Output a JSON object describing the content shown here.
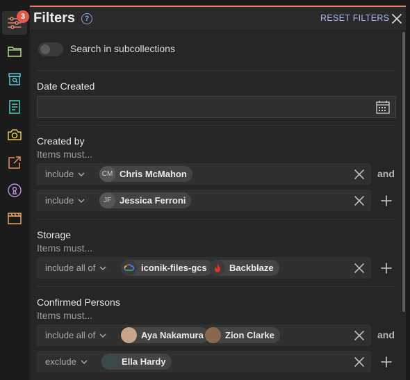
{
  "rail": {
    "badge": "3",
    "items": [
      "filters-icon",
      "folder-icon",
      "collection-search-icon",
      "document-icon",
      "camera-icon",
      "share-icon",
      "keyhole-icon",
      "clapperboard-icon"
    ]
  },
  "header": {
    "title": "Filters",
    "help": "?",
    "reset": "RESET FILTERS"
  },
  "subcollections": {
    "label": "Search in subcollections",
    "enabled": false
  },
  "date_created": {
    "title": "Date Created",
    "value": ""
  },
  "created_by": {
    "title": "Created by",
    "subtitle": "Items must...",
    "rows": [
      {
        "mode": "include",
        "chips": [
          {
            "initials": "CM",
            "name": "Chris McMahon"
          }
        ],
        "conj": "and"
      },
      {
        "mode": "include",
        "chips": [
          {
            "initials": "JF",
            "name": "Jessica Ferroni"
          }
        ]
      }
    ]
  },
  "storage": {
    "title": "Storage",
    "subtitle": "Items must...",
    "rows": [
      {
        "mode": "include all of",
        "chips": [
          {
            "name": "iconik-files-gcs"
          },
          {
            "name": "Backblaze"
          }
        ]
      }
    ]
  },
  "confirmed_persons": {
    "title": "Confirmed Persons",
    "subtitle": "Items must...",
    "rows": [
      {
        "mode": "include all of",
        "chips": [
          {
            "name": "Aya Nakamura"
          },
          {
            "name": "Zion Clarke"
          }
        ],
        "conj": "and"
      },
      {
        "mode": "exclude",
        "chips": [
          {
            "name": "Ella Hardy"
          }
        ]
      }
    ]
  },
  "colors": {
    "accent": "#e4826c",
    "link": "#a5b9ee",
    "badge": "#e05a49",
    "panel": "#262626"
  }
}
